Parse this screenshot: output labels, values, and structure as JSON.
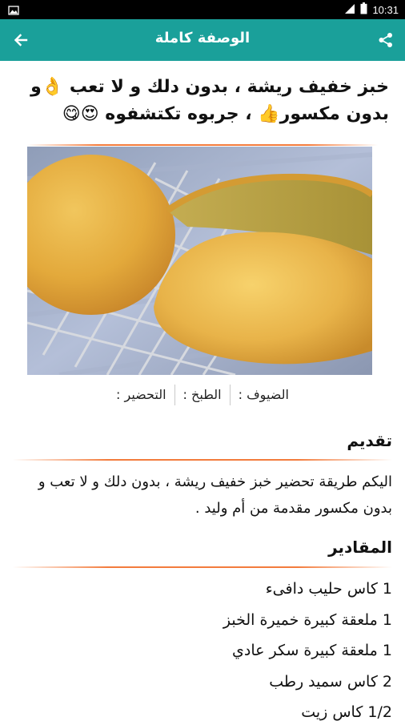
{
  "status_bar": {
    "time": "10:31",
    "notification_icon": "image-icon",
    "signal_icon": "signal-icon",
    "battery_icon": "battery-icon"
  },
  "app_bar": {
    "title": "الوصفة كاملة",
    "back_icon": "arrow-left-icon",
    "share_icon": "share-icon",
    "background_color": "#1aa09a"
  },
  "recipe": {
    "title": "خبز خفيف ريشة ، بدون دلك و لا تعب 👌و بدون مكسور👍 ، جربوه تكتشفوه 😍😋",
    "image_alt": "bread-photo",
    "meta": {
      "guests_label": "الضيوف :",
      "cook_label": "الطبخ :",
      "prep_label": "التحضير :"
    }
  },
  "intro": {
    "heading": "تقديم",
    "text": "اليكم طريقة تحضير خبز خفيف ريشة ، بدون دلك و لا تعب و بدون مكسور مقدمة من أم وليد ."
  },
  "ingredients": {
    "heading": "المقادير",
    "items": [
      "1 كاس حليب دافىء",
      "1 ملعقة كبيرة خميرة الخبز",
      "1 ملعقة كبيرة سكر عادي",
      "2 كاس سميد رطب",
      "1/2 كاس زيت"
    ]
  },
  "colors": {
    "accent_rule": "#f37c3d",
    "toolbar": "#1aa09a"
  }
}
